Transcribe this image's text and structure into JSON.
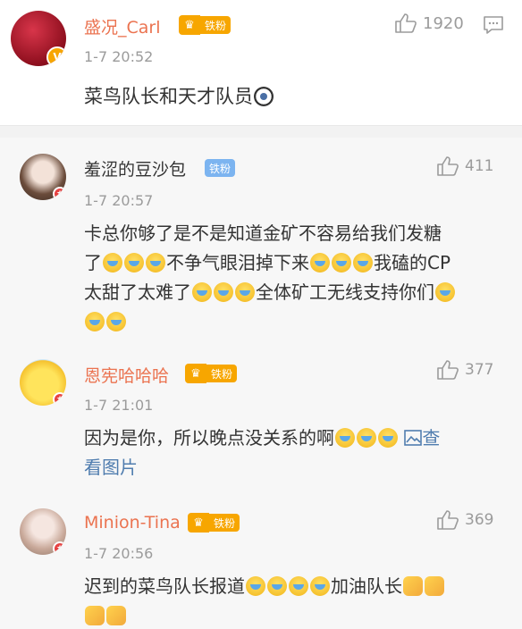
{
  "main_comment": {
    "username": "盛况_Carl",
    "fan_badge": "铁粉",
    "likes": "1920",
    "timestamp": "1-7 20:52",
    "text": "菜鸟队长和天才队员"
  },
  "replies": [
    {
      "username": "羞涩的豆沙包",
      "fan_badge": "铁粉",
      "likes": "411",
      "timestamp": "1-7 20:57",
      "lines": [
        "卡总你够了是不是知道金矿不容易给我们发糖",
        "了",
        "不争气眼泪掉下来",
        "我磕的CP",
        "太甜了太难了",
        "全体矿工无线支持你们"
      ]
    },
    {
      "username": "恩宪哈哈哈",
      "fan_badge": "铁粉",
      "likes": "377",
      "timestamp": "1-7 21:01",
      "text": "因为是你，所以晚点没关系的啊",
      "link_text": "查看图片",
      "link_part1": "查",
      "link_part2": "看图片"
    },
    {
      "username": "Minion-Tina",
      "fan_badge": "铁粉",
      "likes": "369",
      "timestamp": "1-7 20:56",
      "text": "迟到的菜鸟队长报道",
      "text2": "加油队长"
    }
  ],
  "colors": {
    "username_orange": "#eb7350",
    "link_blue": "#507daf",
    "badge_orange": "#f7a600",
    "badge_blue": "#7cb4f0"
  }
}
